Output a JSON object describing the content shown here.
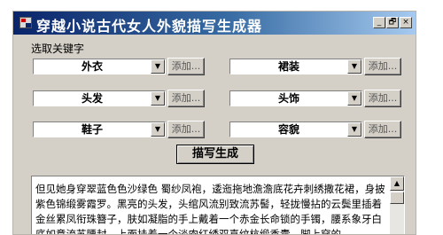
{
  "window": {
    "title": "穿越小说古代女人外貌描写生成器",
    "controls": {
      "minimize": "_",
      "maximize": "🗗",
      "close": "×"
    }
  },
  "keywords": {
    "label": "选取关键字",
    "items": [
      {
        "key": "outerwear",
        "value": "外衣",
        "add_label": "添加..."
      },
      {
        "key": "skirt",
        "value": "裙装",
        "add_label": "添加..."
      },
      {
        "key": "hair",
        "value": "头发",
        "add_label": "添加..."
      },
      {
        "key": "headwear",
        "value": "头饰",
        "add_label": "添加..."
      },
      {
        "key": "shoes",
        "value": "鞋子",
        "add_label": "添加..."
      },
      {
        "key": "looks",
        "value": "容貌",
        "add_label": "添加..."
      }
    ]
  },
  "generate_button": "描写生成",
  "output": {
    "text": "但见她身穿翠蓝色色沙绿色 蜀纱凤袍，逶迤拖地澹澹底花卉刺绣撒花裙，身披紫色锦缎雾霞罗。黑亮的头发，头绾风流别致流苏髻，轻拢慢拈的云鬓里插着金丝累凤衔珠簪子，肤如凝脂的手上戴着一个赤金长命锁的手镯，腰系象牙白底如意流苏腰封，上面挂着一个淡肉红绣双喜纹杭缎香囊，脚上穿的"
  },
  "icons": {
    "app": "app-icon",
    "dropdown": "chevron-down-icon",
    "scroll_up": "scroll-up-arrow-icon"
  },
  "colors": {
    "title_gradient_start": "#0a246a",
    "title_gradient_end": "#a6caf0",
    "face": "#d4d0c8"
  }
}
